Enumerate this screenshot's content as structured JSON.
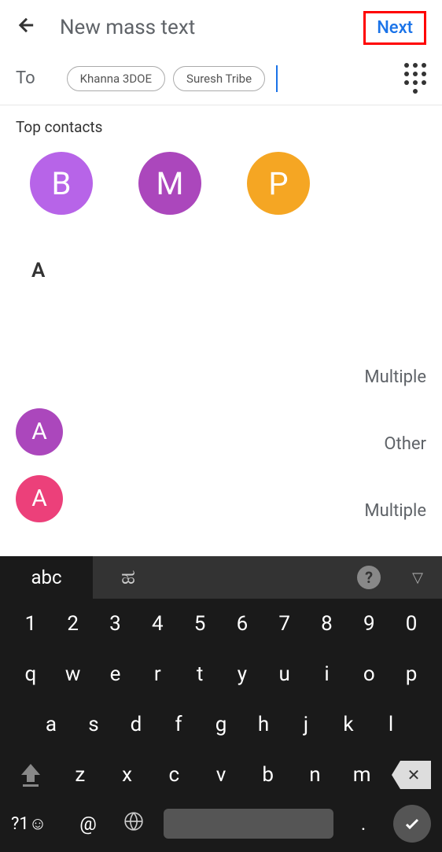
{
  "header": {
    "title": "New mass text",
    "next_label": "Next"
  },
  "to": {
    "label": "To",
    "chips": [
      "Khanna 3DOE",
      "Suresh Tribe"
    ]
  },
  "sections": {
    "top_contacts_label": "Top contacts",
    "top_contacts": [
      {
        "letter": "B",
        "color": "purple-light"
      },
      {
        "letter": "M",
        "color": "purple"
      },
      {
        "letter": "P",
        "color": "orange"
      }
    ],
    "letter_header": "A",
    "contacts": [
      {
        "avatar": "",
        "meta": "Multiple",
        "color": ""
      },
      {
        "avatar": "A",
        "meta": "Other",
        "color": "purple"
      },
      {
        "avatar": "A",
        "meta": "Multiple",
        "color": "pink"
      }
    ]
  },
  "keyboard": {
    "mode": "abc",
    "alt_script": "ಹ",
    "row1": [
      "1",
      "2",
      "3",
      "4",
      "5",
      "6",
      "7",
      "8",
      "9",
      "0"
    ],
    "row2": [
      "q",
      "w",
      "e",
      "r",
      "t",
      "y",
      "u",
      "i",
      "o",
      "p"
    ],
    "row3": [
      "a",
      "s",
      "d",
      "f",
      "g",
      "h",
      "j",
      "k",
      "l"
    ],
    "row4": [
      "z",
      "x",
      "c",
      "v",
      "b",
      "n",
      "m"
    ],
    "sym": "?1☺",
    "at": "@",
    "period": "."
  }
}
